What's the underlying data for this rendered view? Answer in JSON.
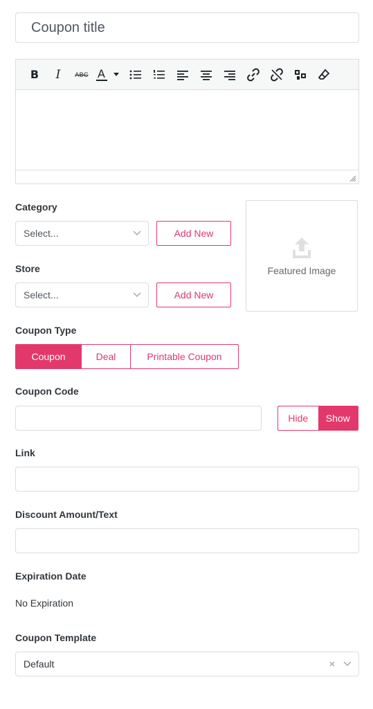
{
  "title_field": {
    "placeholder": "Coupon title"
  },
  "editor": {
    "toolbar": [
      {
        "name": "bold-icon",
        "glyph": "B"
      },
      {
        "name": "italic-icon",
        "glyph": "I"
      },
      {
        "name": "strikethrough-icon",
        "glyph": "ABC"
      },
      {
        "name": "text-color-icon",
        "glyph": "A"
      }
    ]
  },
  "category": {
    "label": "Category",
    "select_placeholder": "Select...",
    "add_new": "Add New"
  },
  "store": {
    "label": "Store",
    "select_placeholder": "Select...",
    "add_new": "Add New"
  },
  "featured_image": {
    "label": "Featured Image"
  },
  "coupon_type": {
    "label": "Coupon Type",
    "options": [
      "Coupon",
      "Deal",
      "Printable Coupon"
    ],
    "selected": "Coupon"
  },
  "coupon_code": {
    "label": "Coupon Code",
    "value": "",
    "hide_label": "Hide",
    "show_label": "Show",
    "selected": "Show"
  },
  "link": {
    "label": "Link",
    "value": ""
  },
  "discount": {
    "label": "Discount Amount/Text",
    "value": ""
  },
  "expiration": {
    "label": "Expiration Date",
    "value": "No Expiration"
  },
  "template": {
    "label": "Coupon Template",
    "value": "Default"
  },
  "colors": {
    "accent": "#e2386b",
    "border": "#dcdcde",
    "toolbar_bg": "#f6f7f7",
    "text": "#32373c"
  }
}
